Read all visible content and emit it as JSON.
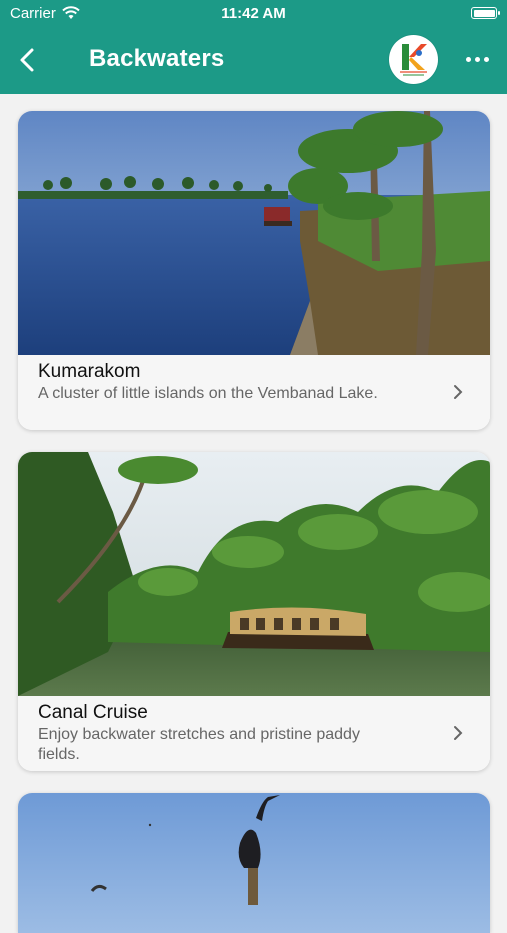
{
  "status_bar": {
    "carrier": "Carrier",
    "time": "11:42 AM"
  },
  "header": {
    "title": "Backwaters"
  },
  "colors": {
    "header": "#1c9a87",
    "card_body": "#f6f6f6"
  },
  "cards": [
    {
      "title": "Kumarakom",
      "description": "A cluster of little islands on the Vembanad Lake."
    },
    {
      "title": "Canal Cruise",
      "description": "Enjoy backwater stretches and pristine paddy fields."
    },
    {
      "title": "",
      "description": ""
    }
  ]
}
